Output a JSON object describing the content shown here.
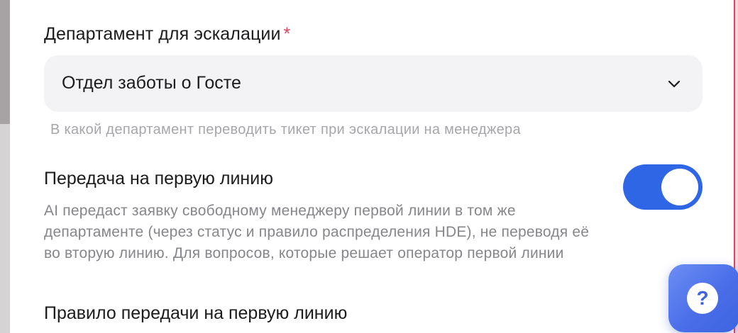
{
  "escalation": {
    "label": "Департамент для эскалации",
    "required_mark": "*",
    "selected_value": "Отдел заботы о Госте",
    "hint": "В какой департамент переводить тикет при эскалации на менеджера"
  },
  "first_line_handoff": {
    "title": "Передача на первую линию",
    "description": "AI передаст заявку свободному менеджеру первой линии в том же департаменте (через статус и правило распределения HDE), не переводя её во вторую линию. Для вопросов, которые решает оператор первой линии",
    "enabled": true
  },
  "first_line_rule": {
    "title": "Правило передачи на первую линию"
  },
  "help_button": {
    "glyph": "?"
  },
  "colors": {
    "accent": "#2f66e5",
    "required": "#e0455e"
  },
  "icons": {
    "select_chevron": "chevron-down-icon",
    "help": "question-icon"
  }
}
